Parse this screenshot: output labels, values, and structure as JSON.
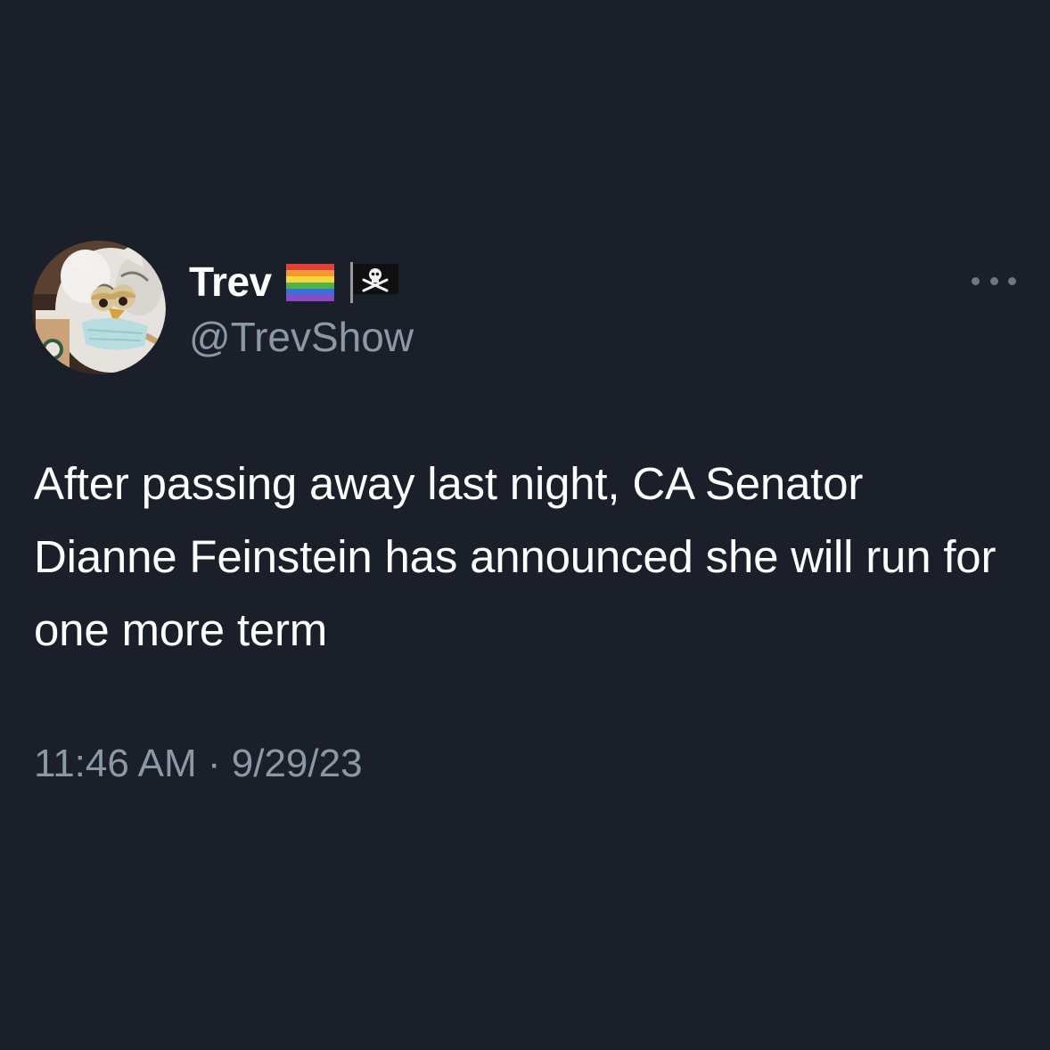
{
  "tweet": {
    "display_name": "Trev",
    "badges": [
      "rainbow-flag-icon",
      "pirate-flag-icon"
    ],
    "handle": "@TrevShow",
    "text": "After passing away last night, CA Senator Dianne Feinstein has announced she will run for one more term",
    "time": "11:46 AM",
    "separator": "·",
    "date": "9/29/23",
    "more_icon": "ellipsis-icon"
  },
  "colors": {
    "background": "#1a1f29",
    "primary_text": "#ffffff",
    "secondary_text": "#8b98a5"
  }
}
